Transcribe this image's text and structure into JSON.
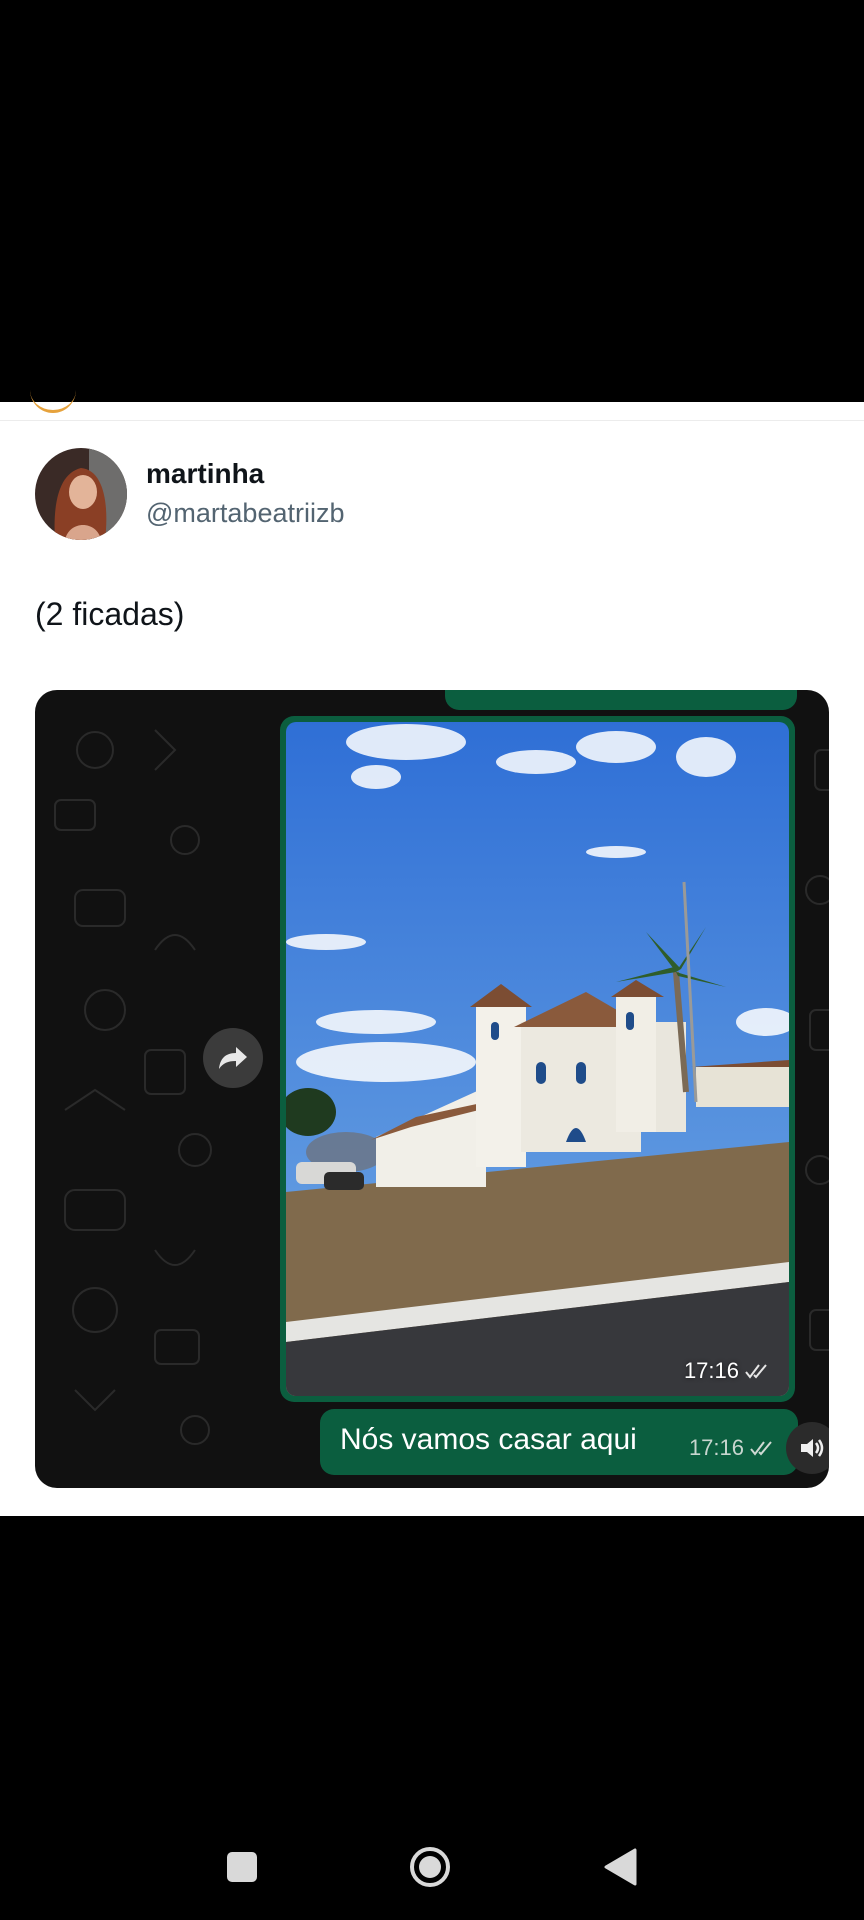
{
  "tweet": {
    "display_name": "martinha",
    "handle": "@martabeatriizb",
    "text": "(2 ficadas)"
  },
  "chat": {
    "photo_time": "17:16",
    "message_text": "Nós vamos casar aqui",
    "message_time": "17:16"
  },
  "icons": {
    "forward": "forward-arrow-icon",
    "read_receipt": "double-check-icon",
    "speaker": "speaker-icon",
    "nav_recents": "square-icon",
    "nav_home": "circle-icon",
    "nav_back": "triangle-back-icon"
  },
  "colors": {
    "bubble": "#0b5e3f",
    "chat_bg": "#111111",
    "handle": "#536471"
  }
}
